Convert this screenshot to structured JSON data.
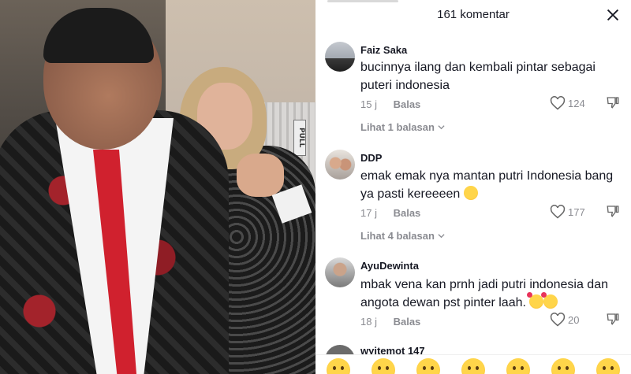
{
  "comments_panel": {
    "title": "161 komentar",
    "close_icon": "close-icon"
  },
  "comments": [
    {
      "username": "Faiz Saka",
      "text": "bucinnya ilang dan kembali pintar sebagai puteri indonesia",
      "emoji": "",
      "time": "15 j",
      "reply_label": "Balas",
      "likes": "124",
      "view_replies": "Lihat 1 balasan"
    },
    {
      "username": "DDP",
      "text": "emak emak nya mantan putri Indonesia bang ya pasti kereeeen",
      "emoji": "sweat-smile-emoji",
      "time": "17 j",
      "reply_label": "Balas",
      "likes": "177",
      "view_replies": "Lihat 4 balasan"
    },
    {
      "username": "AyuDewinta",
      "text": "mbak vena kan prnh jadi putri indonesia dan angota dewan pst pinter laah.",
      "emoji": "smiling-hearts-emoji x2",
      "time": "18 j",
      "reply_label": "Balas",
      "likes": "20",
      "view_replies": ""
    }
  ],
  "partial_comment": {
    "username": "wyitemot 147"
  },
  "emoji_bar": [
    "grinning-emoji",
    "smiling-hearts-emoji",
    "tears-of-joy-emoji",
    "surprised-emoji",
    "smirk-emoji",
    "sweat-smile-emoji",
    "flushed-emoji"
  ],
  "colors": {
    "text_primary": "#161823",
    "text_secondary": "#8a8b91"
  }
}
